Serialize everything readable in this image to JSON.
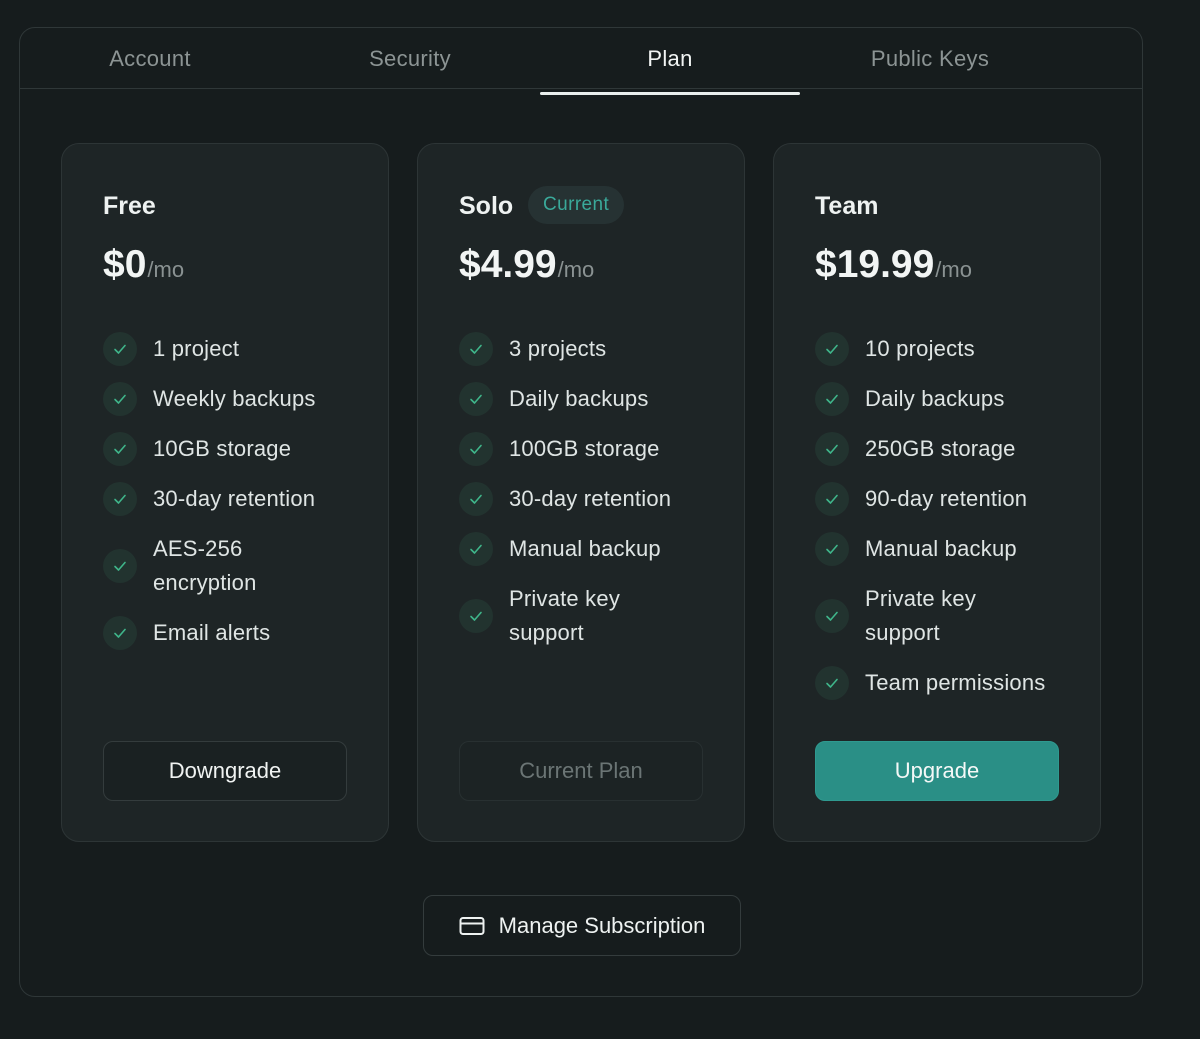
{
  "tabs": [
    {
      "label": "Account",
      "active": false
    },
    {
      "label": "Security",
      "active": false
    },
    {
      "label": "Plan",
      "active": true
    },
    {
      "label": "Public Keys",
      "active": false
    }
  ],
  "plans": [
    {
      "name": "Free",
      "price": "$0",
      "unit": "/mo",
      "features": [
        "1 project",
        "Weekly backups",
        "10GB storage",
        "30-day retention",
        "AES-256 encryption",
        "Email alerts"
      ],
      "button_label": "Downgrade"
    },
    {
      "name": "Solo",
      "badge": "Current",
      "price": "$4.99",
      "unit": "/mo",
      "features": [
        "3 projects",
        "Daily backups",
        "100GB storage",
        "30-day retention",
        "Manual backup",
        "Private key support"
      ],
      "button_label": "Current Plan"
    },
    {
      "name": "Team",
      "price": "$19.99",
      "unit": "/mo",
      "features": [
        "10 projects",
        "Daily backups",
        "250GB storage",
        "90-day retention",
        "Manual backup",
        "Private key support",
        "Team permissions"
      ],
      "button_label": "Upgrade"
    }
  ],
  "manage_subscription": {
    "label": "Manage Subscription",
    "icon": "credit-card-icon"
  },
  "colors": {
    "accent": "#2a8f86",
    "badge_text": "#3aa99a",
    "check": "#3fb58a",
    "background": "#161c1d",
    "card": "#1e2526"
  }
}
